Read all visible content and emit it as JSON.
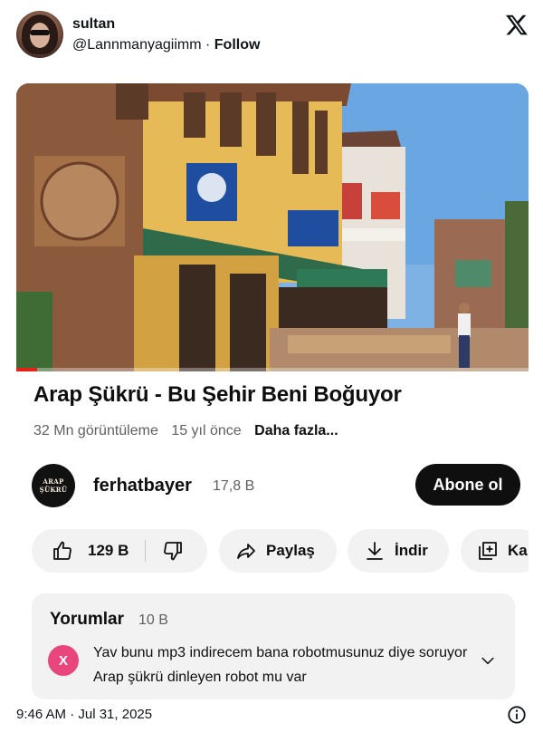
{
  "tweet": {
    "author_name": "sultan",
    "author_handle": "@Lannmanyagiimm",
    "separator": "·",
    "follow_label": "Follow",
    "timestamp": "9:46 AM · Jul 31, 2025"
  },
  "video": {
    "title": "Arap Şükrü - Bu Şehir Beni Boğuyor",
    "views": "32 Mn görüntüleme",
    "age": "15 yıl önce",
    "more_label": "Daha fazla...",
    "progress_fraction": 0.04
  },
  "channel": {
    "avatar_text_line1": "ARAP",
    "avatar_text_line2": "ŞÜKRÜ",
    "name": "ferhatbayer",
    "subscribers": "17,8 B",
    "subscribe_label": "Abone ol"
  },
  "actions": {
    "like_count": "129 B",
    "share_label": "Paylaş",
    "download_label": "İndir",
    "save_label": "Ka"
  },
  "comments": {
    "title": "Yorumlar",
    "count": "10 B",
    "first_comment_avatar": "X",
    "first_comment_text": "Yav bunu mp3 indirecem bana robotmusunuz diye soruyor Arap şükrü dinleyen robot mu var"
  },
  "icons": {
    "x_logo": "x-logo-icon",
    "like": "thumbs-up-icon",
    "dislike": "thumbs-down-icon",
    "share": "share-arrow-icon",
    "download": "download-icon",
    "save": "add-to-playlist-icon",
    "expand": "chevron-down-icon",
    "info": "info-icon"
  },
  "colors": {
    "progress": "#e62117",
    "comment_avatar": "#e8467c",
    "pill_bg": "#f2f2f2",
    "subscribe_bg": "#0f0f0f"
  }
}
